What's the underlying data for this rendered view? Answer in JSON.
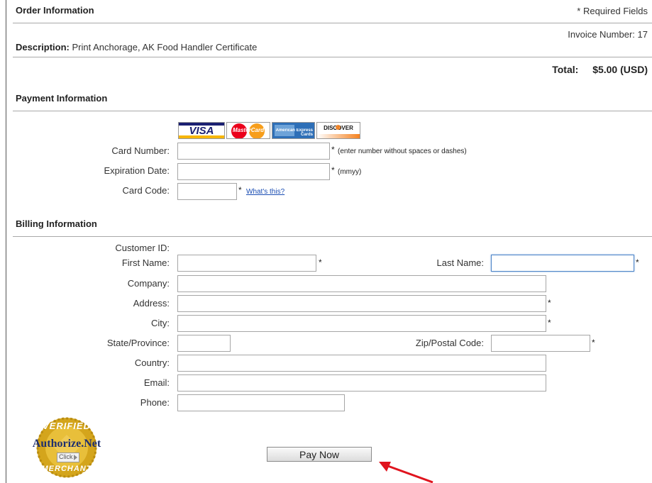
{
  "order": {
    "header": "Order Information",
    "required_note": "* Required Fields",
    "invoice_label": "Invoice Number:",
    "invoice_number": "17",
    "description_label": "Description:",
    "description_value": "Print Anchorage, AK Food Handler Certificate",
    "total_label": "Total:",
    "total_value": "$5.00 (USD)"
  },
  "payment": {
    "header": "Payment Information",
    "cards": [
      "VISA",
      "MasterCard",
      "American Express Cards",
      "DISCOVER"
    ],
    "card_number_label": "Card Number:",
    "card_number_value": "",
    "card_number_hint": "(enter number without spaces or dashes)",
    "expiration_label": "Expiration Date:",
    "expiration_value": "",
    "expiration_hint": "(mmyy)",
    "card_code_label": "Card Code:",
    "card_code_value": "",
    "card_code_link": "What's this?"
  },
  "billing": {
    "header": "Billing Information",
    "customer_id_label": "Customer ID:",
    "first_name_label": "First Name:",
    "last_name_label": "Last Name:",
    "company_label": "Company:",
    "address_label": "Address:",
    "city_label": "City:",
    "state_label": "State/Province:",
    "zip_label": "Zip/Postal Code:",
    "country_label": "Country:",
    "email_label": "Email:",
    "phone_label": "Phone:"
  },
  "required_mark": "*",
  "badge": {
    "top_text": "VERIFIED",
    "brand": "Authorize.Net",
    "click_text": "Click",
    "bottom_text": "MERCHANT"
  },
  "pay_button_label": "Pay Now",
  "colors": {
    "link": "#1a4db3",
    "arrow": "#e0141e",
    "badge_gold": "#d4a51c",
    "brand_navy": "#1e2f6f"
  }
}
